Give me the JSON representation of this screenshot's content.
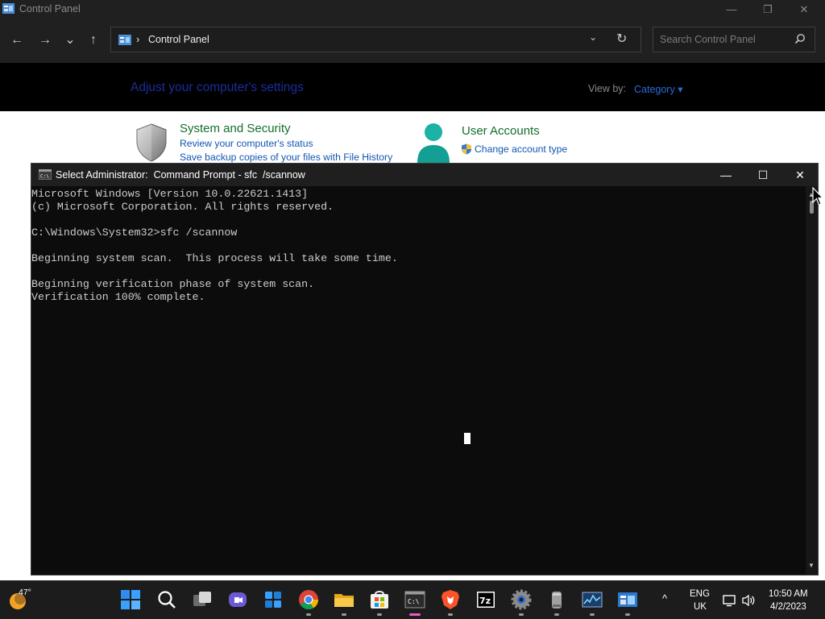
{
  "control_panel": {
    "window_title": "Control Panel",
    "window_buttons": {
      "minimize": "—",
      "restore": "❐",
      "close": "✕"
    },
    "nav": {
      "back": "←",
      "forward": "→",
      "recent": "⌄",
      "up": "↑"
    },
    "address": {
      "chevron": "›",
      "path": "Control Panel",
      "dropdown": "⌄",
      "refresh": "↻"
    },
    "search": {
      "placeholder": "Search Control Panel"
    },
    "heading": "Adjust your computer's settings",
    "view_by": {
      "label": "View by:",
      "value": "Category ▾"
    },
    "categories": [
      {
        "title": "System and Security",
        "icon": "shield-icon",
        "links": [
          "Review your computer's status",
          "Save backup copies of your files with File History"
        ]
      },
      {
        "title": "User Accounts",
        "icon": "user-icon",
        "links": [
          "Change account type"
        ]
      }
    ]
  },
  "cmd": {
    "title": "Select Administrator:  Command Prompt - sfc  /scannow",
    "buttons": {
      "minimize": "—",
      "maximize": "☐",
      "close": "✕"
    },
    "lines": [
      "Microsoft Windows [Version 10.0.22621.1413]",
      "(c) Microsoft Corporation. All rights reserved.",
      "",
      "C:\\Windows\\System32>sfc /scannow",
      "",
      "Beginning system scan.  This process will take some time.",
      "",
      "Beginning verification phase of system scan.",
      "Verification 100% complete."
    ],
    "scroll": {
      "up": "▲",
      "down": "▼"
    }
  },
  "taskbar": {
    "weather": {
      "temp": "47°"
    },
    "apps": [
      "start",
      "search",
      "task-view",
      "teams",
      "widgets",
      "chrome",
      "file-explorer",
      "microsoft-store",
      "command-prompt",
      "brave",
      "7zip",
      "settings",
      "disk-cleanup",
      "resource-monitor",
      "control-panel"
    ],
    "active_app": "command-prompt",
    "tray": {
      "chevron": "^",
      "lang1": "ENG",
      "lang2": "UK",
      "time": "10:50 AM",
      "date": "4/2/2023"
    }
  },
  "colors": {
    "cmd_bg": "#0c0c0c",
    "cmd_text": "#cccccc",
    "titlebar": "#202020",
    "cp_link": "#1156b3",
    "cp_title": "#136e2b",
    "active_indicator": "#e85cc6"
  }
}
